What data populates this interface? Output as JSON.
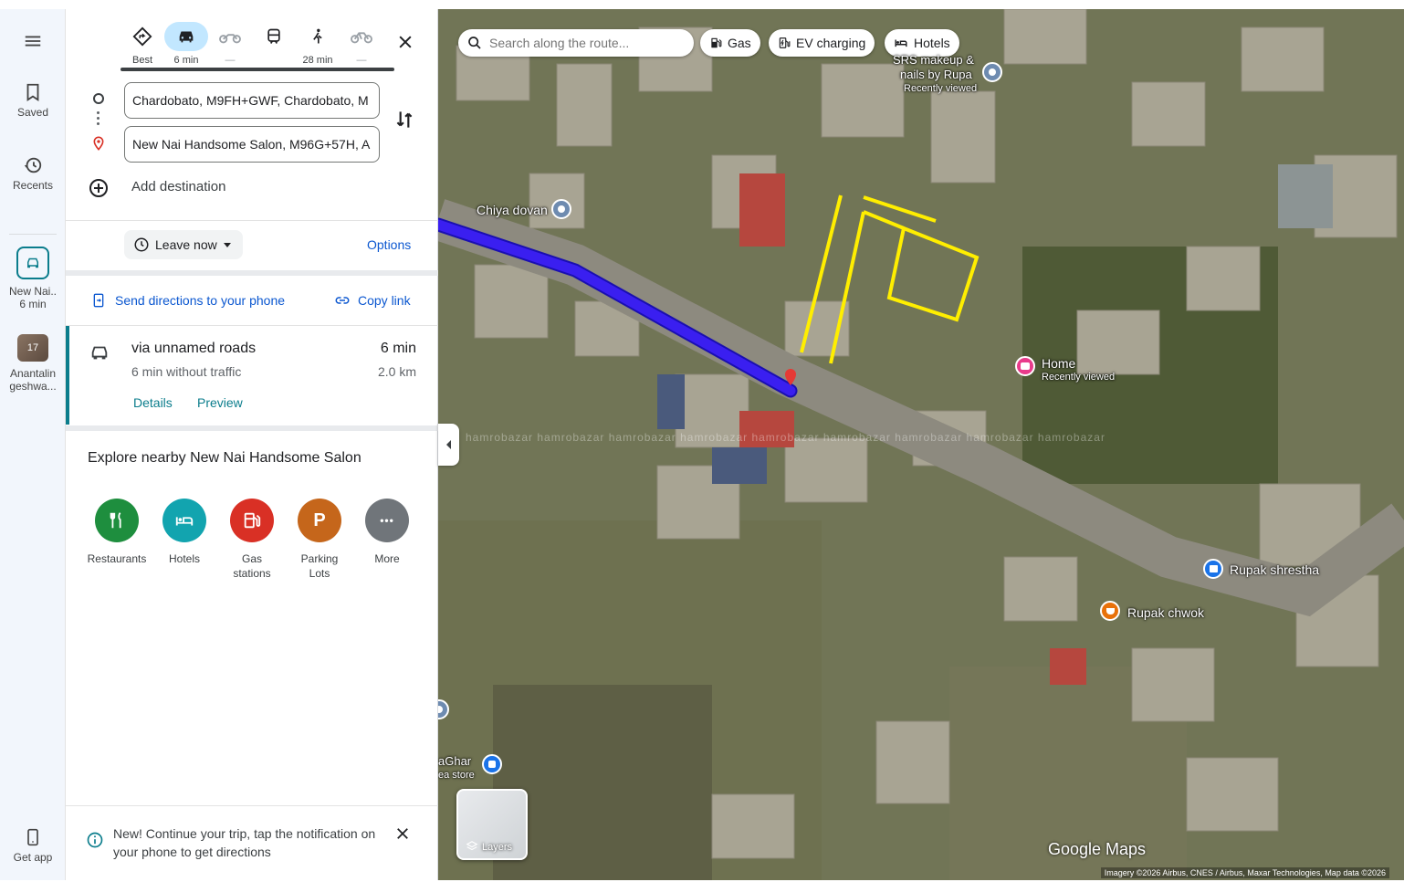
{
  "rail": {
    "saved": "Saved",
    "recents": "Recents",
    "recent_route_line1": "New Nai..",
    "recent_route_line2": "6 min",
    "recent_place_badge": "17",
    "recent_place_line1": "Anantalin",
    "recent_place_line2": "geshwa...",
    "get_app": "Get app"
  },
  "modes": [
    {
      "label": "Best",
      "icon": "diamond-directions-icon"
    },
    {
      "label": "6 min",
      "icon": "car-icon",
      "active": true
    },
    {
      "label": "—",
      "icon": "motorcycle-icon"
    },
    {
      "label": "",
      "icon": "transit-icon"
    },
    {
      "label": "28 min",
      "icon": "walk-icon"
    },
    {
      "label": "—",
      "icon": "bicycle-icon"
    }
  ],
  "route": {
    "origin": "Chardobato, M9FH+GWF, Chardobato, M",
    "destination": "New Nai Handsome Salon, M96G+57H, A",
    "add_destination": "Add destination",
    "leave_now": "Leave now",
    "options": "Options",
    "send_directions": "Send directions to your phone",
    "copy_link": "Copy link"
  },
  "route_card": {
    "via": "via unnamed roads",
    "time": "6 min",
    "traffic": "6 min without traffic",
    "distance": "2.0 km",
    "details": "Details",
    "preview": "Preview"
  },
  "explore": {
    "title": "Explore nearby New Nai Handsome Salon",
    "items": [
      {
        "line1": "Restaurants",
        "line2": "",
        "color": "#1e8e3e",
        "icon": "fork-knife-icon"
      },
      {
        "line1": "Hotels",
        "line2": "",
        "color": "#12a4af",
        "icon": "bed-icon"
      },
      {
        "line1": "Gas",
        "line2": "stations",
        "color": "#d93025",
        "icon": "gas-pump-icon"
      },
      {
        "line1": "Parking",
        "line2": "Lots",
        "color": "#c5661b",
        "icon": "parking-icon",
        "glyph": "P"
      },
      {
        "line1": "More",
        "line2": "",
        "color": "#70757a",
        "icon": "more-dots-icon",
        "glyph": "•••"
      }
    ]
  },
  "notice": {
    "text": "New! Continue your trip, tap the notification on your phone to get directions"
  },
  "map": {
    "search_placeholder": "Search along the route...",
    "chips": {
      "gas": "Gas",
      "ev": "EV charging",
      "hotels": "Hotels"
    },
    "labels": {
      "srs1": "SRS makeup &",
      "srs2": "nails by Rupa",
      "srs_sub": "Recently viewed",
      "chiya": "Chiya dovan",
      "home": "Home",
      "home_sub": "Recently viewed",
      "rupak_shrestha": "Rupak shrestha",
      "rupak_chwok": "Rupak chwok",
      "aghar": "aGhar",
      "aghar_sub": "ea store"
    },
    "watermark": "hamrobazar   hamrobazar   hamrobazar   hamrobazar   hamrobazar   hamrobazar   hamrobazar   hamrobazar   hamrobazar",
    "layers": "Layers",
    "logo": "Google Maps",
    "attribution": "Imagery ©2026 Airbus, CNES / Airbus, Maxar Technologies, Map data ©2026",
    "colors": {
      "route": "#3a1ff0",
      "annotation": "#ffee00"
    }
  }
}
